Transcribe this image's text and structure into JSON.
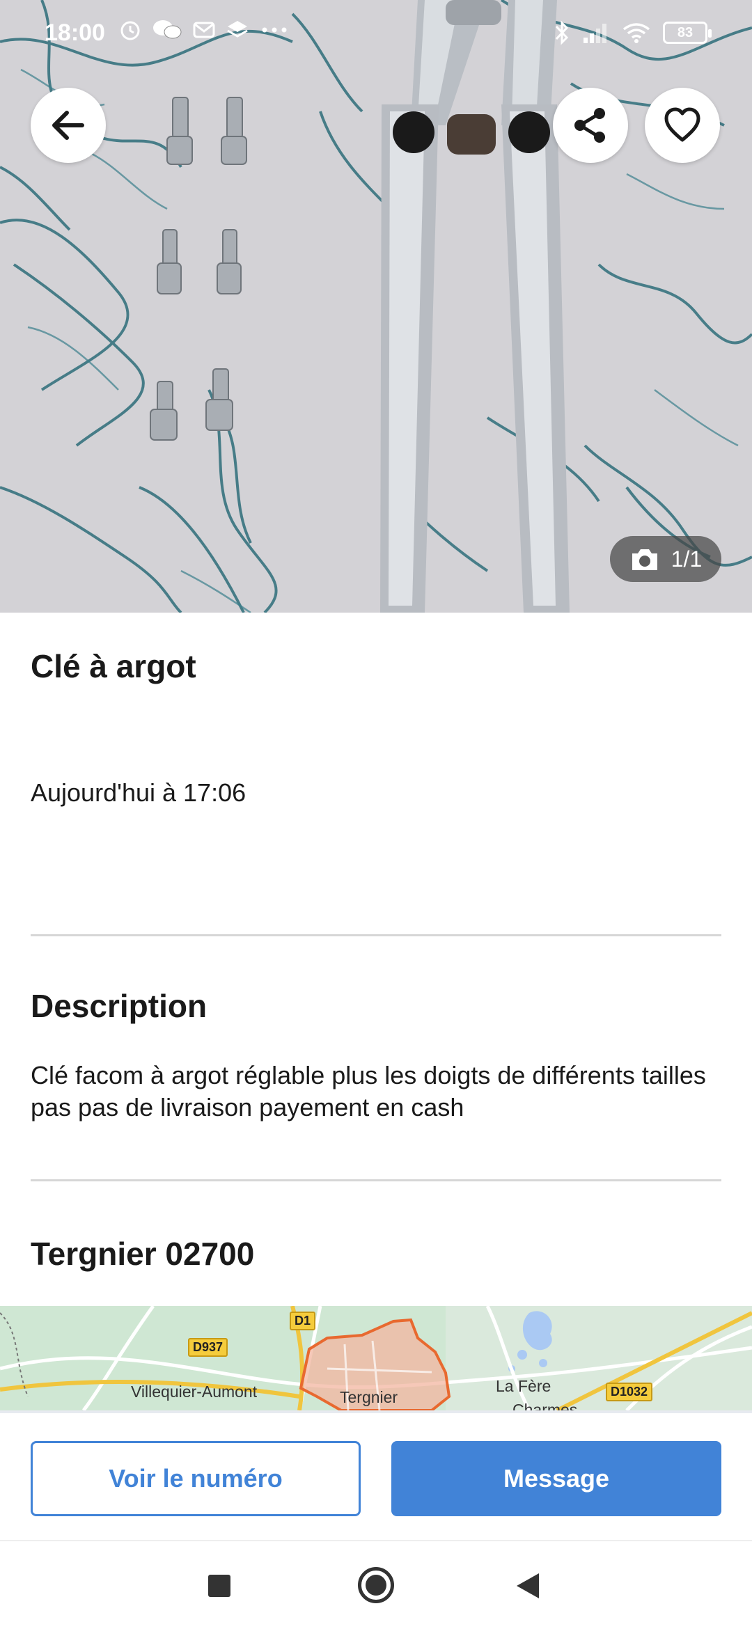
{
  "status_bar": {
    "time": "18:00",
    "left_icons": [
      "alarm-icon",
      "chat-icon",
      "mail-icon",
      "layers-icon",
      "more-icon"
    ],
    "right_icons": [
      "bluetooth-icon",
      "signal-icon",
      "wifi-icon"
    ],
    "battery": "83"
  },
  "hero": {
    "photo_counter": "1/1"
  },
  "listing": {
    "title": "Clé à argot",
    "date": "Aujourd'hui à 17:06"
  },
  "description": {
    "heading": "Description",
    "text": "Clé facom à argot réglable plus les doigts de différents tailles pas pas de livraison payement en cash"
  },
  "location": {
    "heading": "Tergnier 02700",
    "map_labels": {
      "villequier": "Villequier-Aumont",
      "tergnier": "Tergnier",
      "lafere": "La Fère",
      "charmes": "Charmes",
      "d937": "D937",
      "d1": "D1",
      "d1032": "D1032"
    }
  },
  "actions": {
    "phone_label": "Voir le numéro",
    "message_label": "Message"
  },
  "colors": {
    "accent": "#4183d7",
    "map_green": "#cfe7d3",
    "map_highlight": "#f3b6a0"
  }
}
